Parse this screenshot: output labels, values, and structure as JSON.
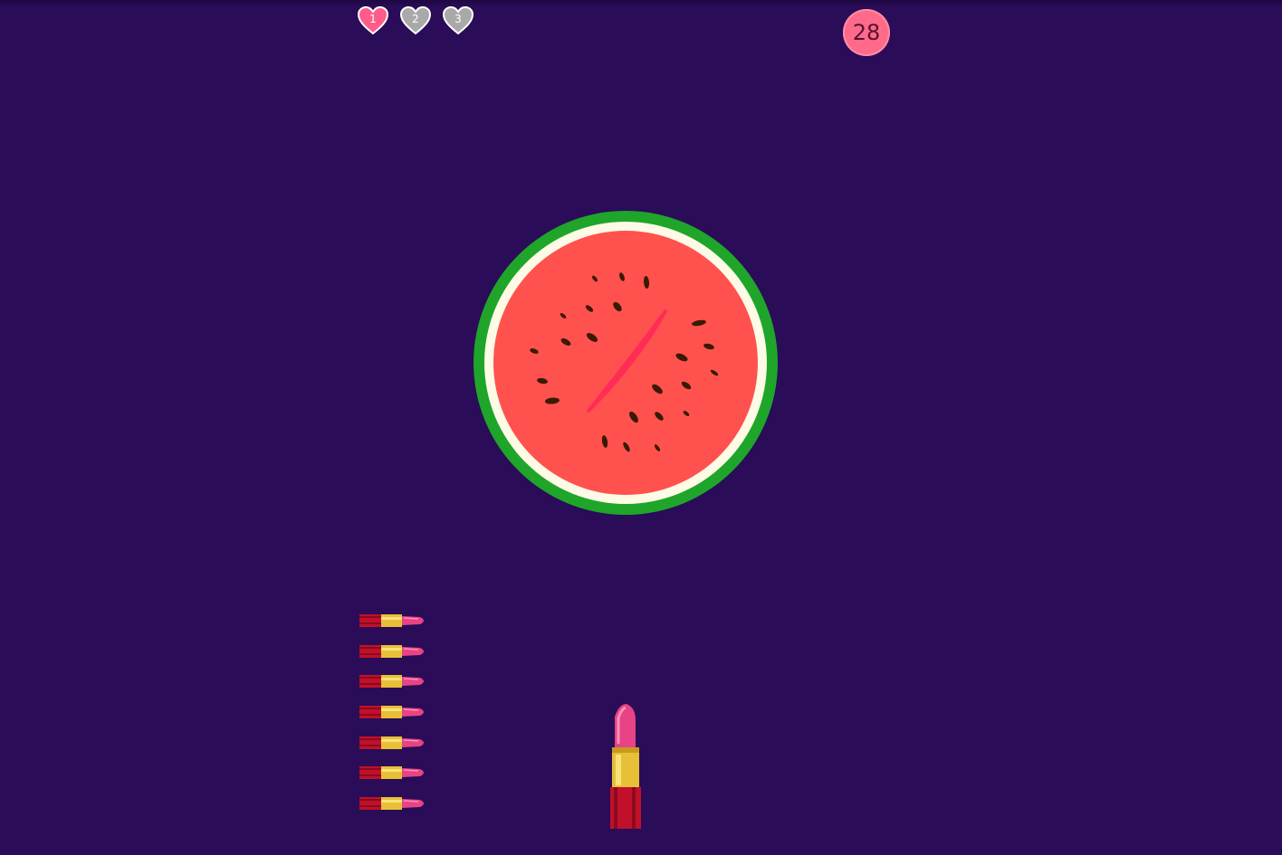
{
  "hud": {
    "lives": [
      {
        "label": "1",
        "active": true
      },
      {
        "label": "2",
        "active": false
      },
      {
        "label": "3",
        "active": false
      }
    ],
    "score": "28"
  },
  "target": {
    "type": "watermelon-slice"
  },
  "ammo": {
    "remaining": 7
  },
  "colors": {
    "background": "#2a0c58",
    "heart_active": "#ff5c8a",
    "heart_inactive": "#a9a9a9",
    "score_badge": "#ff6a8a",
    "rind": "#1fa52a",
    "flesh": "#ff524f",
    "lipstick_pink": "#e84384",
    "lipstick_gold": "#e8c038",
    "lipstick_red": "#c2102a"
  }
}
